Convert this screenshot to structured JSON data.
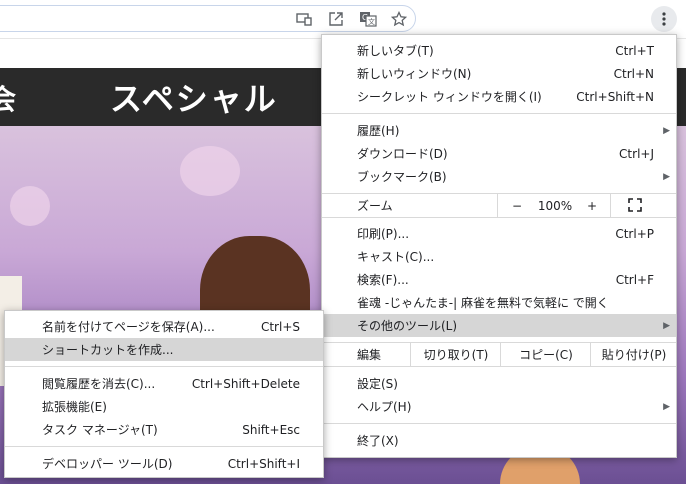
{
  "toolbar": {
    "icons": [
      "cast-icon",
      "open-in-app-icon",
      "translate-icon",
      "bookmark-star-icon",
      "more-menu-icon"
    ]
  },
  "page": {
    "banner_title": "スペシャル",
    "banner_left_fragment": "会"
  },
  "main_menu": {
    "new_tab": {
      "label": "新しいタブ(T)",
      "shortcut": "Ctrl+T"
    },
    "new_window": {
      "label": "新しいウィンドウ(N)",
      "shortcut": "Ctrl+N"
    },
    "incognito": {
      "label": "シークレット ウィンドウを開く(I)",
      "shortcut": "Ctrl+Shift+N"
    },
    "history": {
      "label": "履歴(H)"
    },
    "downloads": {
      "label": "ダウンロード(D)",
      "shortcut": "Ctrl+J"
    },
    "bookmarks": {
      "label": "ブックマーク(B)"
    },
    "zoom": {
      "label": "ズーム",
      "minus": "−",
      "value": "100%",
      "plus": "+"
    },
    "print": {
      "label": "印刷(P)...",
      "shortcut": "Ctrl+P"
    },
    "cast": {
      "label": "キャスト(C)..."
    },
    "find": {
      "label": "検索(F)...",
      "shortcut": "Ctrl+F"
    },
    "open_in_app": {
      "label": "雀魂 -じゃんたま-| 麻雀を無料で気軽に で開く"
    },
    "more_tools": {
      "label": "その他のツール(L)"
    },
    "edit": {
      "label": "編集",
      "cut": "切り取り(T)",
      "copy": "コピー(C)",
      "paste": "貼り付け(P)"
    },
    "settings": {
      "label": "設定(S)"
    },
    "help": {
      "label": "ヘルプ(H)"
    },
    "exit": {
      "label": "終了(X)"
    }
  },
  "sub_menu": {
    "save_page": {
      "label": "名前を付けてページを保存(A)...",
      "shortcut": "Ctrl+S"
    },
    "create_shortcut": {
      "label": "ショートカットを作成..."
    },
    "clear_data": {
      "label": "閲覧履歴を消去(C)...",
      "shortcut": "Ctrl+Shift+Delete"
    },
    "extensions": {
      "label": "拡張機能(E)"
    },
    "task_manager": {
      "label": "タスク マネージャ(T)",
      "shortcut": "Shift+Esc"
    },
    "devtools": {
      "label": "デベロッパー ツール(D)",
      "shortcut": "Ctrl+Shift+I"
    }
  }
}
